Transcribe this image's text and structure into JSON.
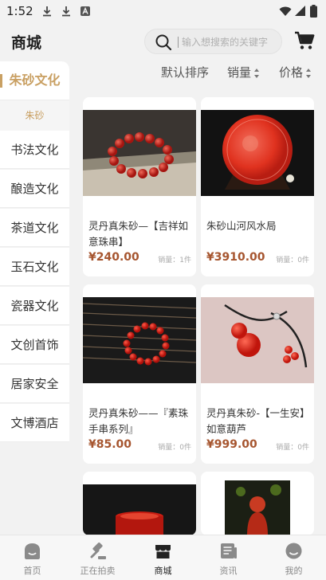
{
  "status_bar": {
    "time": "1:52"
  },
  "header": {
    "title": "商城",
    "search_placeholder": "输入想搜索的关键字"
  },
  "sidebar": {
    "items": [
      {
        "label": "朱砂文化",
        "active": true
      },
      {
        "label": "书法文化"
      },
      {
        "label": "酿造文化"
      },
      {
        "label": "茶道文化"
      },
      {
        "label": "玉石文化"
      },
      {
        "label": "瓷器文化"
      },
      {
        "label": "文创首饰"
      },
      {
        "label": "居家安全"
      },
      {
        "label": "文博酒店"
      }
    ],
    "subitem": "朱砂"
  },
  "sort": {
    "default": "默认排序",
    "sales": "销量",
    "price": "价格"
  },
  "products": [
    {
      "title": "灵丹真朱砂—【吉祥如意珠串】",
      "price": "¥240.00",
      "sold": "销量：1件"
    },
    {
      "title": "朱砂山河风水局",
      "price": "¥3910.00",
      "sold": "销量：0件"
    },
    {
      "title": "灵丹真朱砂——『素珠手串系列』",
      "price": "¥85.00",
      "sold": "销量：0件"
    },
    {
      "title": "灵丹真朱砂-【一生安】如意葫芦",
      "price": "¥999.00",
      "sold": "销量：0件"
    }
  ],
  "tabs": [
    {
      "label": "首页",
      "icon": "home-icon"
    },
    {
      "label": "正在拍卖",
      "icon": "gavel-icon"
    },
    {
      "label": "商城",
      "icon": "store-icon",
      "active": true
    },
    {
      "label": "资讯",
      "icon": "news-icon"
    },
    {
      "label": "我的",
      "icon": "profile-icon"
    }
  ],
  "colors": {
    "accent": "#c9a063",
    "price": "#a6552f",
    "cinnabar": "#d8291f"
  }
}
